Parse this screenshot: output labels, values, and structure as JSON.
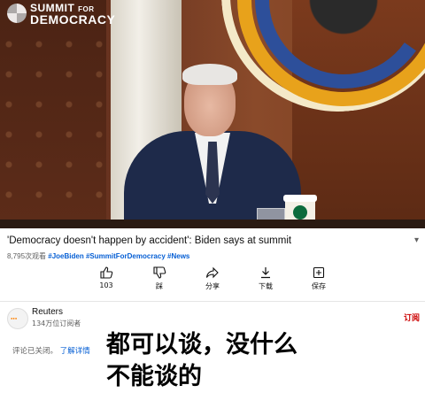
{
  "video": {
    "logo_line1": "SUMMIT",
    "logo_line1_small": "FOR",
    "logo_line2": "DEMOCRACY"
  },
  "title": "'Democracy doesn't happen by accident': Biden says at summit",
  "meta": {
    "views": "8,795次观看",
    "tags": [
      "#JoeBiden",
      "#SummitForDemocracy",
      "#News"
    ]
  },
  "actions": [
    {
      "icon": "thumbs-up-icon",
      "label": "103"
    },
    {
      "icon": "thumbs-down-icon",
      "label": "踩"
    },
    {
      "icon": "share-icon",
      "label": "分享"
    },
    {
      "icon": "download-icon",
      "label": "下载"
    },
    {
      "icon": "save-icon",
      "label": "保存"
    }
  ],
  "channel": {
    "name": "Reuters",
    "subscribers": "134万位订阅者",
    "subscribe_label": "订阅"
  },
  "comments": {
    "status": "评论已关闭。",
    "more_link": "了解详情"
  },
  "overlay": {
    "line1": "都可以谈，没什么",
    "line2": "不能谈的"
  }
}
